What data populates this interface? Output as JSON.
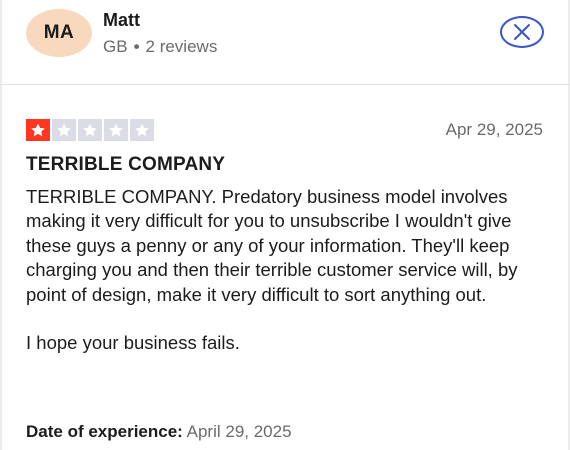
{
  "reviewer": {
    "initials": "MA",
    "name": "Matt",
    "country": "GB",
    "separator": "•",
    "reviews_count": "2 reviews"
  },
  "rating": {
    "value": 1,
    "max": 5,
    "filled_color": "#ff3722",
    "empty_color": "#dcdce6"
  },
  "review": {
    "date": "Apr 29, 2025",
    "title": "TERRIBLE COMPANY",
    "paragraphs": [
      "TERRIBLE COMPANY. Predatory business model involves making it very difficult for you to unsubscribe I wouldn't give these guys a penny or any of your information. They'll keep charging you and then their terrible customer service will, by point of design, make it very difficult to sort anything out.",
      "I hope your business fails."
    ]
  },
  "experience": {
    "label": "Date of experience:",
    "value": "April 29, 2025"
  },
  "icons": {
    "close": "close-icon",
    "star": "star-icon"
  },
  "colors": {
    "avatar_bg": "#f9d9bd",
    "close_button_border": "#3a54c9"
  }
}
